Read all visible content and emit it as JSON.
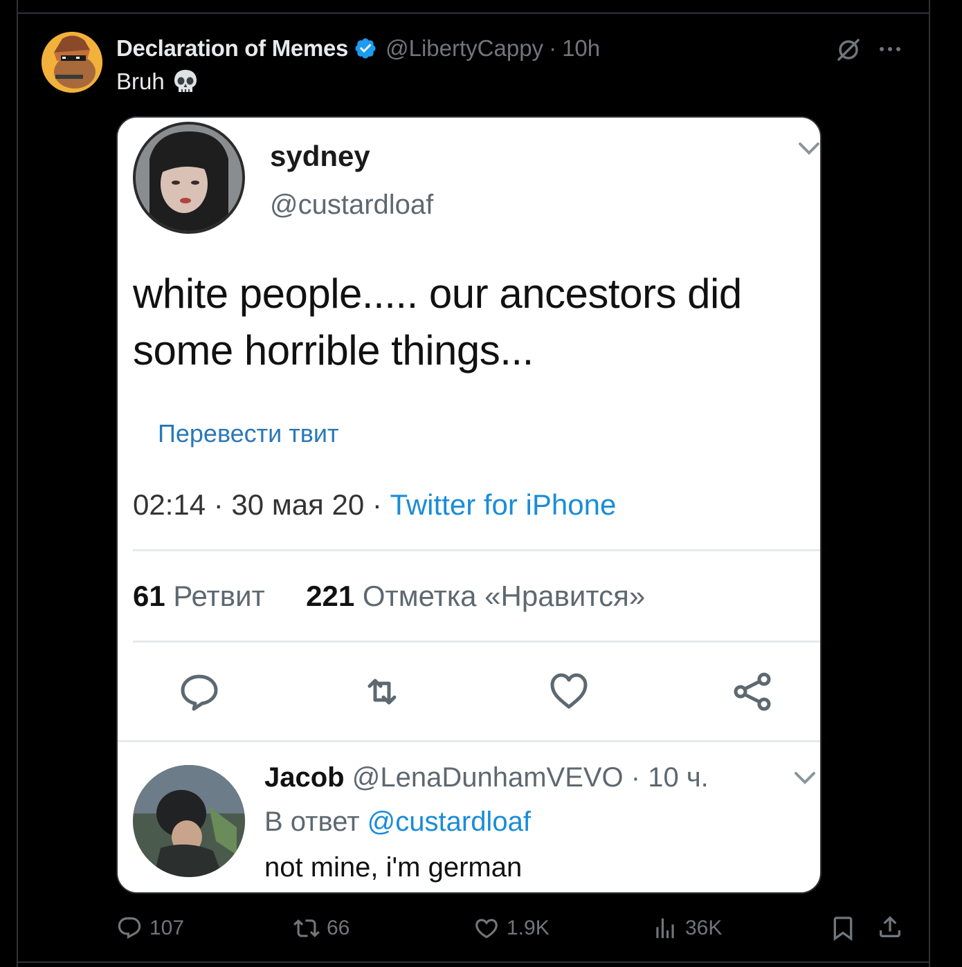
{
  "post": {
    "author_name": "Declaration of Memes",
    "handle": "@LibertyCappy",
    "separator": "·",
    "time": "10h",
    "text": "Bruh"
  },
  "quoted": {
    "name": "sydney",
    "handle": "@custardloaf",
    "text": "white people..... our ancestors did some horrible things...",
    "translate": "Перевести твит",
    "meta_time": "02:14 · 30 мая 20 · ",
    "meta_source": "Twitter for iPhone",
    "retweets_count": "61",
    "retweets_label": "Ретвит",
    "likes_count": "221",
    "likes_label": "Отметка «Нравится»"
  },
  "reply": {
    "name": "Jacob",
    "handle_time": "@LenaDunhamVEVO · 10 ч.",
    "replying_prefix": "В ответ",
    "replying_mention": "@custardloaf",
    "text": "not mine, i'm german"
  },
  "actions": {
    "replies": "107",
    "reposts": "66",
    "likes": "1.9K",
    "views": "36K"
  },
  "colors": {
    "background": "#000000",
    "text": "#e7e9ea",
    "muted": "#71767b",
    "verified": "#1d9bf0",
    "link": "#1a8cd8"
  }
}
